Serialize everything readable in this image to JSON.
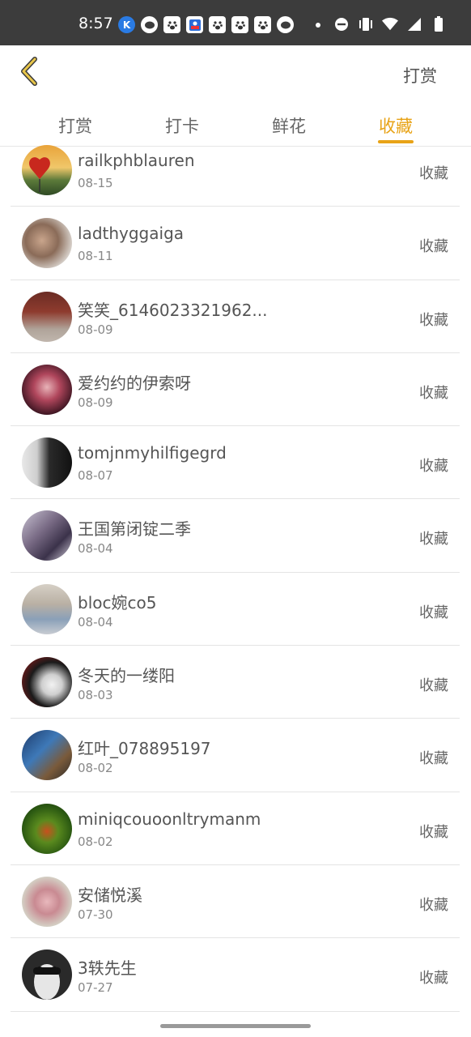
{
  "status_bar": {
    "time": "8:57",
    "notification_icons": [
      "k-app-icon",
      "chat-bubble-icon",
      "baidu-paw-icon",
      "baidu-news-icon",
      "baidu-paw-icon",
      "baidu-paw-icon",
      "baidu-paw-icon",
      "chat-bubble-icon"
    ],
    "system_icons": [
      "do-not-disturb-icon",
      "vibrate-icon",
      "wifi-icon",
      "signal-icon",
      "battery-icon"
    ]
  },
  "header": {
    "back_icon": "chevron-left-icon",
    "action_label": "打赏",
    "accent_color": "#e8a317"
  },
  "tabs": [
    {
      "label": "打赏",
      "active": false
    },
    {
      "label": "打卡",
      "active": false
    },
    {
      "label": "鲜花",
      "active": false
    },
    {
      "label": "收藏",
      "active": true
    }
  ],
  "list": [
    {
      "name": "railkphblauren",
      "date": "08-15",
      "action": "收藏"
    },
    {
      "name": "ladthyggaiga",
      "date": "08-11",
      "action": "收藏"
    },
    {
      "name": "笑笑_6146023321962...",
      "date": "08-09",
      "action": "收藏"
    },
    {
      "name": "爱约约的伊索呀",
      "date": "08-09",
      "action": "收藏"
    },
    {
      "name": "tomjnmyhilfigegrd",
      "date": "08-07",
      "action": "收藏"
    },
    {
      "name": "王国第闭锭二季",
      "date": "08-04",
      "action": "收藏"
    },
    {
      "name": "bloc婉co5",
      "date": "08-04",
      "action": "收藏"
    },
    {
      "name": "冬天的一缕阳",
      "date": "08-03",
      "action": "收藏"
    },
    {
      "name": "红叶_078895197",
      "date": "08-02",
      "action": "收藏"
    },
    {
      "name": "miniqcouoonltrymanm",
      "date": "08-02",
      "action": "收藏"
    },
    {
      "name": "安储悦溪",
      "date": "07-30",
      "action": "收藏"
    },
    {
      "name": "3轶先生",
      "date": "07-27",
      "action": "收藏"
    }
  ]
}
